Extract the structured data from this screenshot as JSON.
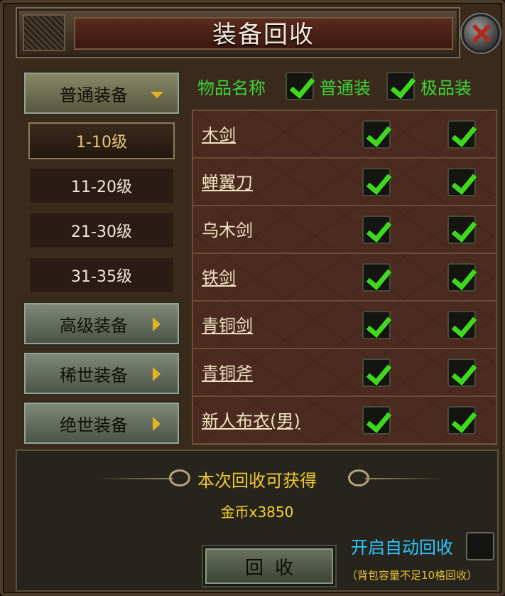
{
  "title": "装备回收",
  "categories": {
    "normal": "普通装备",
    "advanced": "高级装备",
    "rare": "稀世装备",
    "legendary": "绝世装备"
  },
  "levels": [
    "1-10级",
    "11-20级",
    "21-30级",
    "31-35级"
  ],
  "header": {
    "name_col": "物品名称",
    "normal_col": "普通装",
    "excellent_col": "极品装"
  },
  "items": [
    {
      "name": "木剑",
      "normal_checked": true,
      "excellent_checked": true
    },
    {
      "name": "蝉翼刀",
      "normal_checked": true,
      "excellent_checked": true
    },
    {
      "name": "乌木剑",
      "normal_checked": true,
      "excellent_checked": true
    },
    {
      "name": "铁剑",
      "normal_checked": true,
      "excellent_checked": true
    },
    {
      "name": "青铜剑",
      "normal_checked": true,
      "excellent_checked": true
    },
    {
      "name": "青铜斧",
      "normal_checked": true,
      "excellent_checked": true
    },
    {
      "name": "新人布衣(男)",
      "normal_checked": true,
      "excellent_checked": true
    }
  ],
  "reward": {
    "title": "本次回收可获得",
    "gold": "金币x3850"
  },
  "auto": {
    "label": "开启自动回收",
    "note": "（背包容量不足10格回收）",
    "checked": false
  },
  "recycle_button": "回收",
  "colors": {
    "check_green": "#3ed91e",
    "header_green": "#3fd23a",
    "gold_text": "#f2d230",
    "auto_blue": "#2ec8ff"
  }
}
